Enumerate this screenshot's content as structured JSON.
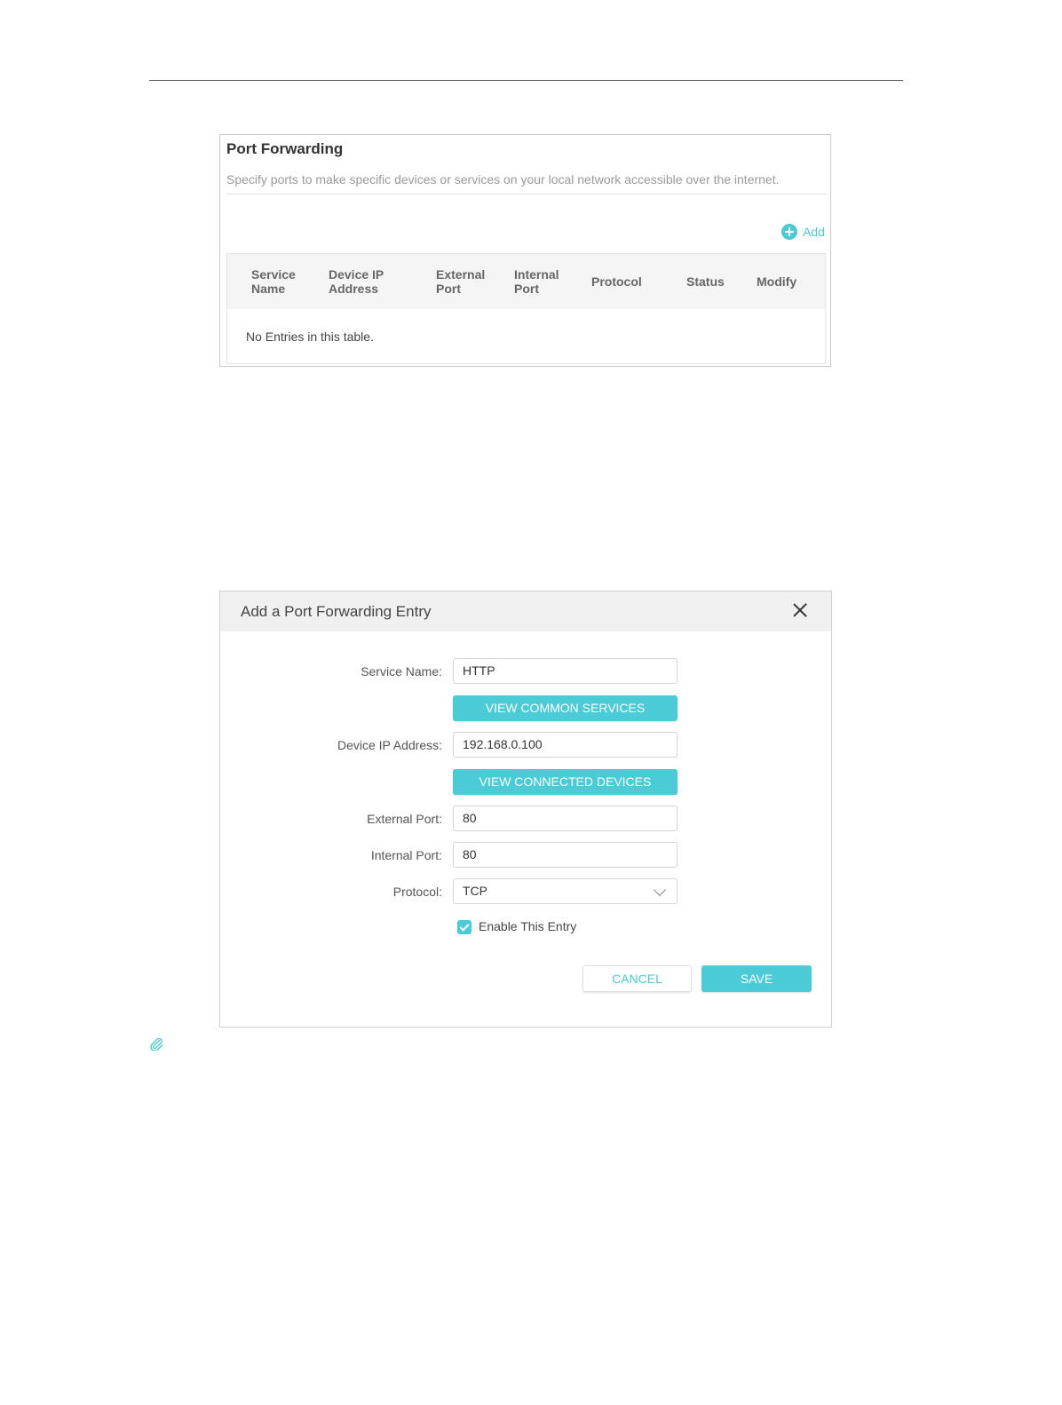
{
  "port_forwarding": {
    "title": "Port Forwarding",
    "description": "Specify ports to make specific devices or services on your local network accessible over the internet.",
    "add_label": "Add",
    "columns": [
      [
        "Service",
        "Name"
      ],
      [
        "Device IP",
        "Address"
      ],
      [
        "External",
        "Port"
      ],
      [
        "Internal",
        "Port"
      ],
      [
        "Protocol"
      ],
      [
        "Status"
      ],
      [
        "Modify"
      ]
    ],
    "empty_text": "No Entries in this table."
  },
  "dialog": {
    "title": "Add a Port Forwarding Entry",
    "service_name_label": "Service Name:",
    "service_name_value": "HTTP",
    "view_common_services_label": "VIEW COMMON SERVICES",
    "device_ip_label": "Device IP Address:",
    "device_ip_value": "192.168.0.100",
    "view_connected_devices_label": "VIEW CONNECTED DEVICES",
    "external_port_label": "External Port:",
    "external_port_value": "80",
    "internal_port_label": "Internal Port:",
    "internal_port_value": "80",
    "protocol_label": "Protocol:",
    "protocol_value": "TCP",
    "enable_entry_label": "Enable This Entry",
    "enable_entry_checked": true,
    "cancel_label": "CANCEL",
    "save_label": "SAVE"
  },
  "colors": {
    "accent": "#4acbd6"
  }
}
